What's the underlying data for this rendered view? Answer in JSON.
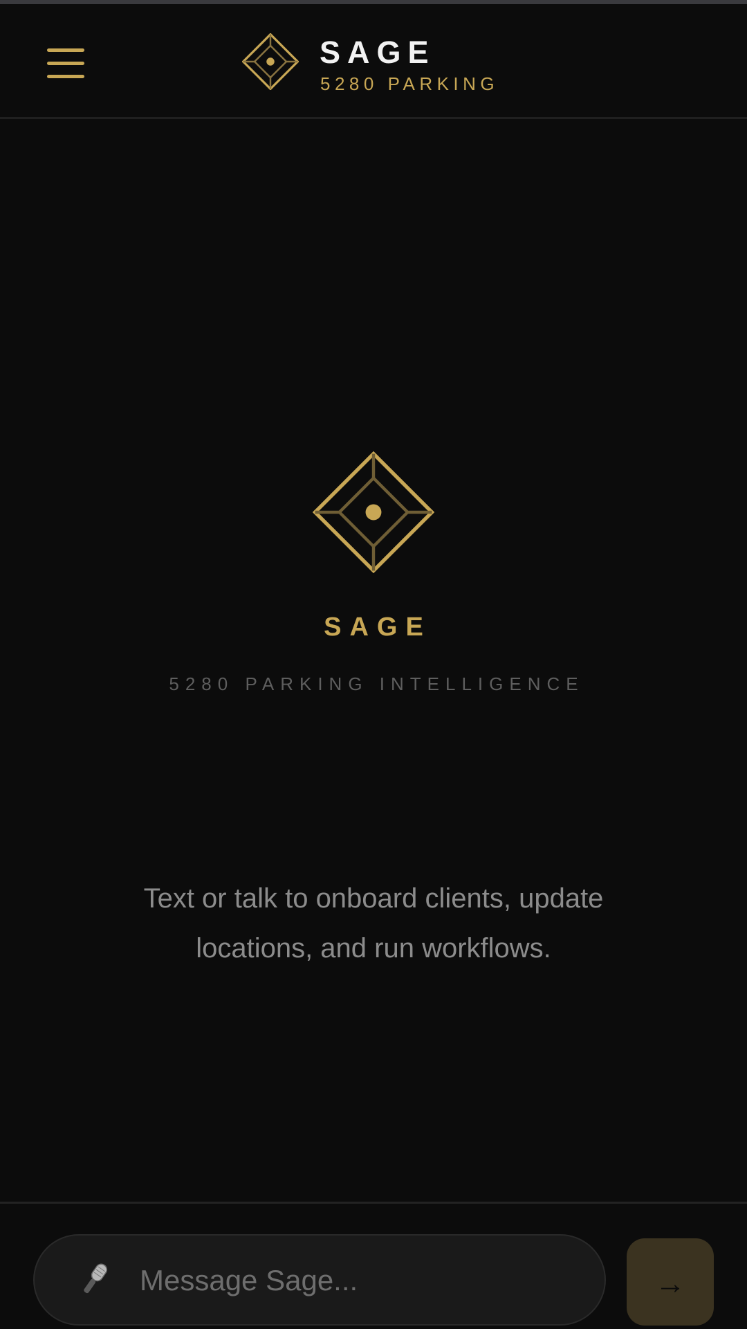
{
  "header": {
    "menu_icon": "hamburger-menu-icon",
    "logo_icon": "diamond-logo-icon",
    "title": "SAGE",
    "subtitle": "5280 PARKING"
  },
  "hero": {
    "logo_icon": "diamond-logo-icon",
    "title": "SAGE",
    "subtitle": "5280 PARKING INTELLIGENCE",
    "description": "Text or talk to onboard clients, update locations, and run workflows."
  },
  "composer": {
    "mic_icon": "microphone-icon",
    "placeholder": "Message Sage...",
    "value": "",
    "send_icon": "arrow-right-icon",
    "send_label": "→"
  },
  "colors": {
    "accent": "#c8a755",
    "background": "#0c0c0c",
    "send_button": "#3b3320"
  }
}
